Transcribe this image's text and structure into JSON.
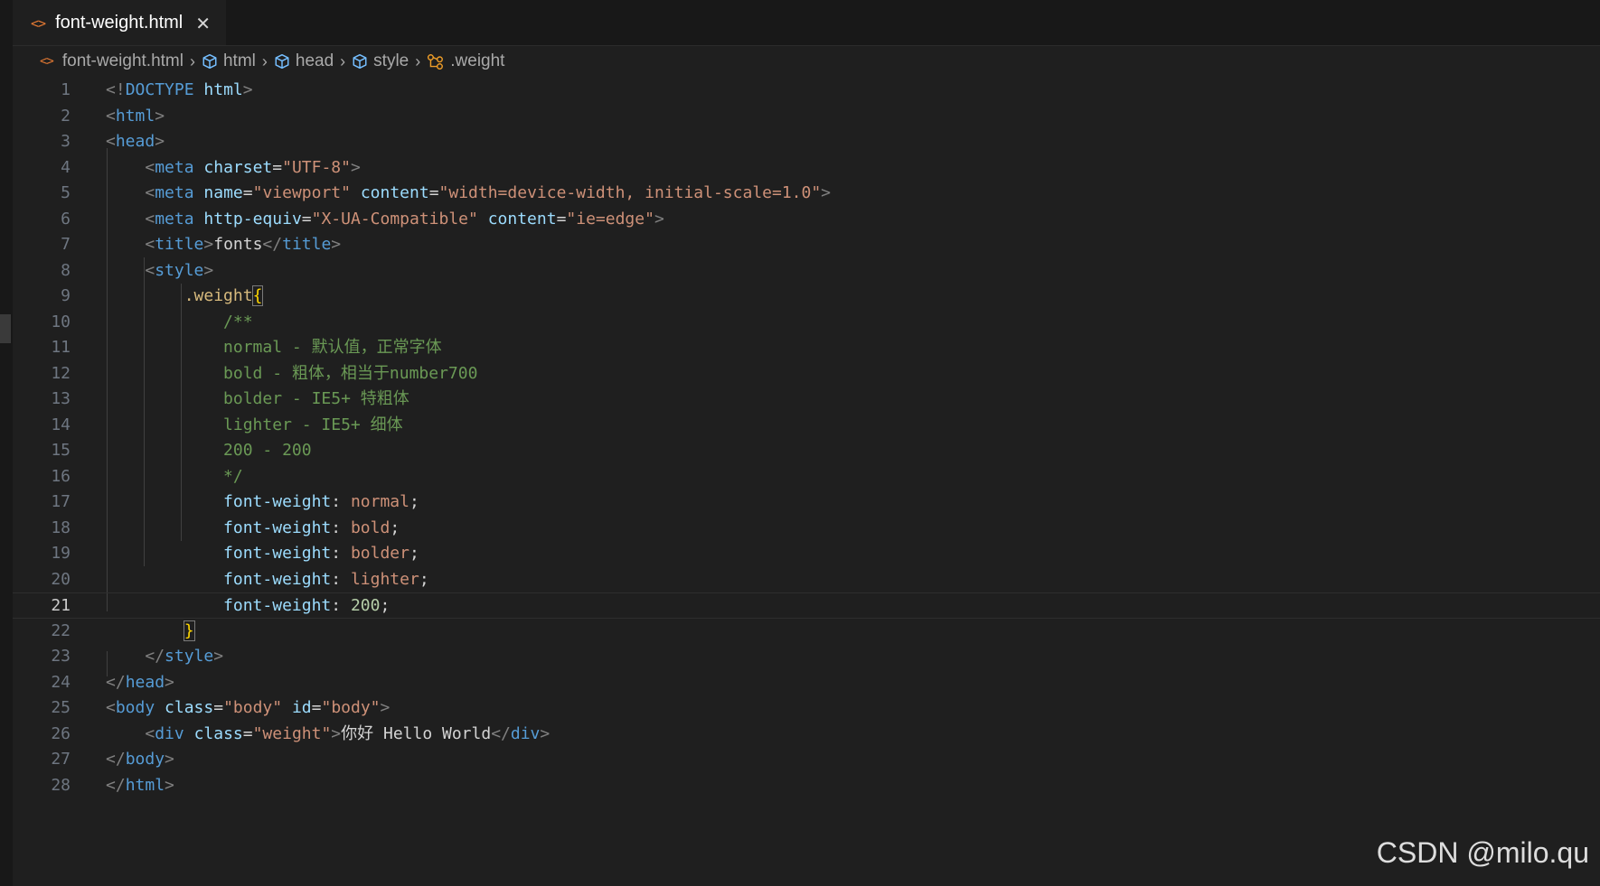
{
  "tab": {
    "icon": "html-file-icon",
    "title": "font-weight.html",
    "close": "✕"
  },
  "breadcrumb": [
    {
      "label": "font-weight.html",
      "icon": "html-file-icon"
    },
    {
      "label": "html",
      "icon": "cube-icon"
    },
    {
      "label": "head",
      "icon": "cube-icon"
    },
    {
      "label": "style",
      "icon": "cube-icon"
    },
    {
      "label": ".weight",
      "icon": "css-class-icon"
    }
  ],
  "editor": {
    "current_line": 21,
    "line_numbers": [
      "1",
      "2",
      "3",
      "4",
      "5",
      "6",
      "7",
      "8",
      "9",
      "10",
      "11",
      "12",
      "13",
      "14",
      "15",
      "16",
      "17",
      "18",
      "19",
      "20",
      "21",
      "22",
      "23",
      "24",
      "25",
      "26",
      "27",
      "28"
    ],
    "lines": [
      "<!DOCTYPE html>",
      "<html>",
      "<head>",
      "    <meta charset=\"UTF-8\">",
      "    <meta name=\"viewport\" content=\"width=device-width, initial-scale=1.0\">",
      "    <meta http-equiv=\"X-UA-Compatible\" content=\"ie=edge\">",
      "    <title>fonts</title>",
      "    <style>",
      "        .weight{",
      "            /**",
      "            normal - 默认值，正常字体",
      "            bold - 粗体，相当于number700",
      "            bolder - IE5+ 特粗体",
      "            lighter - IE5+ 细体",
      "            200 - 200",
      "            */",
      "            font-weight: normal;",
      "            font-weight: bold;",
      "            font-weight: bolder;",
      "            font-weight: lighter;",
      "            font-weight: 200;",
      "        }",
      "    </style>",
      "</head>",
      "<body class=\"body\" id=\"body\">",
      "    <div class=\"weight\">你好 Hello World</div>",
      "</body>",
      "</html>"
    ]
  },
  "watermark": "CSDN @milo.qu",
  "colors": {
    "background": "#1f1f1f",
    "tag": "#569cd6",
    "attribute": "#9cdcfe",
    "string": "#ce9178",
    "comment": "#6a9955",
    "selector": "#d7ba7d",
    "number": "#b5cea8",
    "html_icon": "#e37933"
  }
}
